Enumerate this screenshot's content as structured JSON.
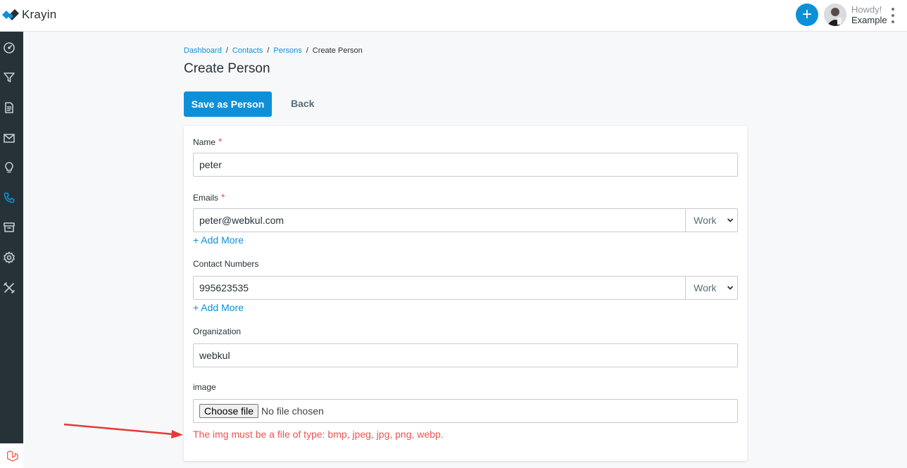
{
  "app": {
    "name": "Krayin"
  },
  "header": {
    "add_icon": "plus-icon",
    "greeting": "Howdy!",
    "username": "Example",
    "menu_icon": "kebab-menu-icon"
  },
  "sidebar": {
    "items": [
      {
        "name": "dashboard",
        "icon": "gauge-icon"
      },
      {
        "name": "leads",
        "icon": "funnel-icon"
      },
      {
        "name": "quotes",
        "icon": "document-icon"
      },
      {
        "name": "mail",
        "icon": "mail-icon"
      },
      {
        "name": "activities",
        "icon": "lightbulb-icon"
      },
      {
        "name": "contacts",
        "icon": "phone-icon",
        "active": true
      },
      {
        "name": "products",
        "icon": "archive-icon"
      },
      {
        "name": "settings",
        "icon": "gear-icon"
      },
      {
        "name": "configuration",
        "icon": "tools-icon"
      }
    ]
  },
  "breadcrumb": {
    "items": [
      "Dashboard",
      "Contacts",
      "Persons",
      "Create Person"
    ],
    "separator": "/"
  },
  "page": {
    "title": "Create Person",
    "save_label": "Save as Person",
    "back_label": "Back"
  },
  "form": {
    "name": {
      "label": "Name",
      "required": "*",
      "value": "peter"
    },
    "emails": {
      "label": "Emails",
      "required": "*",
      "value": "peter@webkul.com",
      "type": "Work",
      "add_more": "+ Add More"
    },
    "contact_numbers": {
      "label": "Contact Numbers",
      "value": "995623535",
      "type": "Work",
      "add_more": "+ Add More"
    },
    "organization": {
      "label": "Organization",
      "value": "webkul"
    },
    "image": {
      "label": "image",
      "button": "Choose file",
      "status": "No file chosen",
      "error": "The img must be a file of type: bmp, jpeg, jpg, png, webp."
    }
  },
  "colors": {
    "primary": "#0e90d9",
    "sidebar": "#263238",
    "error": "#f05153",
    "annotation_arrow": "#e53935"
  }
}
